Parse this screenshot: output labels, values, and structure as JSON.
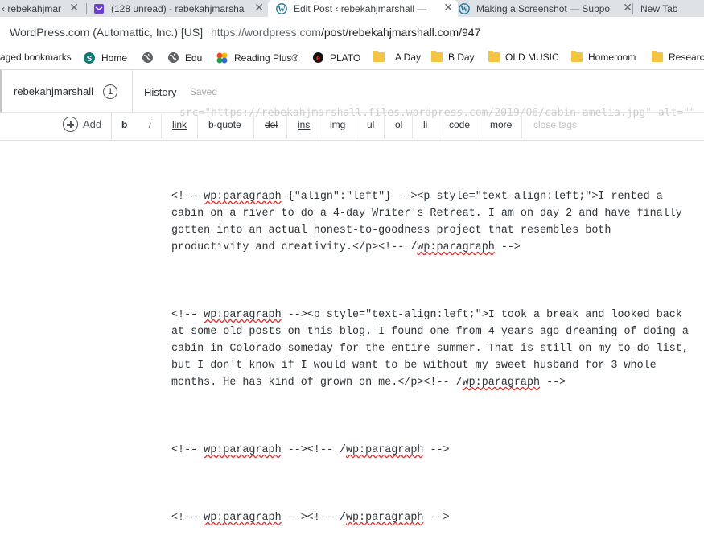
{
  "tabs": [
    {
      "label": "‹ rebekahjmar",
      "icon": "wordpress-icon"
    },
    {
      "label": "(128 unread) - rebekahjmarsha",
      "icon": "yahoo-mail-icon"
    },
    {
      "label": "Edit Post ‹ rebekahjmarshall —",
      "icon": "wordpress-icon",
      "active": true
    },
    {
      "label": "Making a Screenshot — Suppo",
      "icon": "wordpress-icon"
    },
    {
      "label": "New Tab",
      "icon": ""
    }
  ],
  "address": {
    "org": "WordPress.com (Automattic, Inc.) [US]",
    "url_prefix": "https://wordpress.com",
    "url_path": "/post/rebekahjmarshall.com/947"
  },
  "bookmarks": [
    {
      "label": "aged bookmarks",
      "icon": "none"
    },
    {
      "label": "Home",
      "icon": "sharepoint-icon"
    },
    {
      "label": "",
      "icon": "globe-icon"
    },
    {
      "label": "Edu",
      "icon": "globe-icon"
    },
    {
      "label": "Reading Plus®",
      "icon": "reading-plus-icon"
    },
    {
      "label": "PLATO",
      "icon": "plato-icon"
    },
    {
      "label": "A Day",
      "icon": "folder-icon"
    },
    {
      "label": "B Day",
      "icon": "folder-icon"
    },
    {
      "label": "OLD MUSIC",
      "icon": "folder-icon"
    },
    {
      "label": "Homeroom",
      "icon": "folder-icon"
    },
    {
      "label": "Research",
      "icon": "folder-icon"
    }
  ],
  "editor_header": {
    "site": "rebekahjmarshall",
    "count": "1",
    "history": "History",
    "saved": "Saved"
  },
  "toolbar": {
    "add": "Add",
    "tags": [
      "b",
      "i",
      "link",
      "b-quote",
      "del",
      "ins",
      "img",
      "ul",
      "ol",
      "li",
      "code",
      "more",
      "close tags"
    ],
    "ghost_text": "src=\"https://rebekahjmarshall.files.wordpress.com/2019/06/cabin-amelia.jpg\" alt=\"\""
  },
  "content": {
    "para1": {
      "l1_pre": "<!-- ",
      "l1_sq": "wp:paragraph",
      "l1_post": " {\"align\":\"left\"} --><p style=\"text-align:left;\">I rented a",
      "l2": "cabin on a river to do a 4-day Writer's Retreat. I am on day 2 and have finally",
      "l3": "gotten into an actual honest-to-goodness project that resembles both",
      "l4_pre": "productivity and creativity.</p><!-- /",
      "l4_sq": "wp:paragraph",
      "l4_post": " -->"
    },
    "para2": {
      "l1_pre": "<!-- ",
      "l1_sq": "wp:paragraph",
      "l1_post": " --><p style=\"text-align:left;\">I took a break and looked back",
      "l2": "at some old posts on this blog. I found one from 4 years ago dreaming of doing a",
      "l3": "cabin in Colorado someday for the entire summer. That is still on my to-do list,",
      "l4": "but I don't know if I would want to be without my sweet husband for 3 whole",
      "l5_pre": "months. He has kind of grown on me.</p><!-- /",
      "l5_sq": "wp:paragraph",
      "l5_post": " -->"
    },
    "para3": {
      "l1_pre": "<!-- ",
      "l1_sq": "wp:paragraph",
      "l1_mid": " --><!-- /",
      "l1_sq2": "wp:paragraph",
      "l1_post": " -->"
    },
    "para4": {
      "l1_pre": "<!-- ",
      "l1_sq": "wp:paragraph",
      "l1_mid": " --><!-- /",
      "l1_sq2": "wp:paragraph",
      "l1_post": " -->"
    }
  },
  "colors": {
    "tab_strip": "#dee1e6",
    "wp_blue": "#21759b",
    "folder": "#f4c542",
    "spell_error": "#e03131"
  }
}
